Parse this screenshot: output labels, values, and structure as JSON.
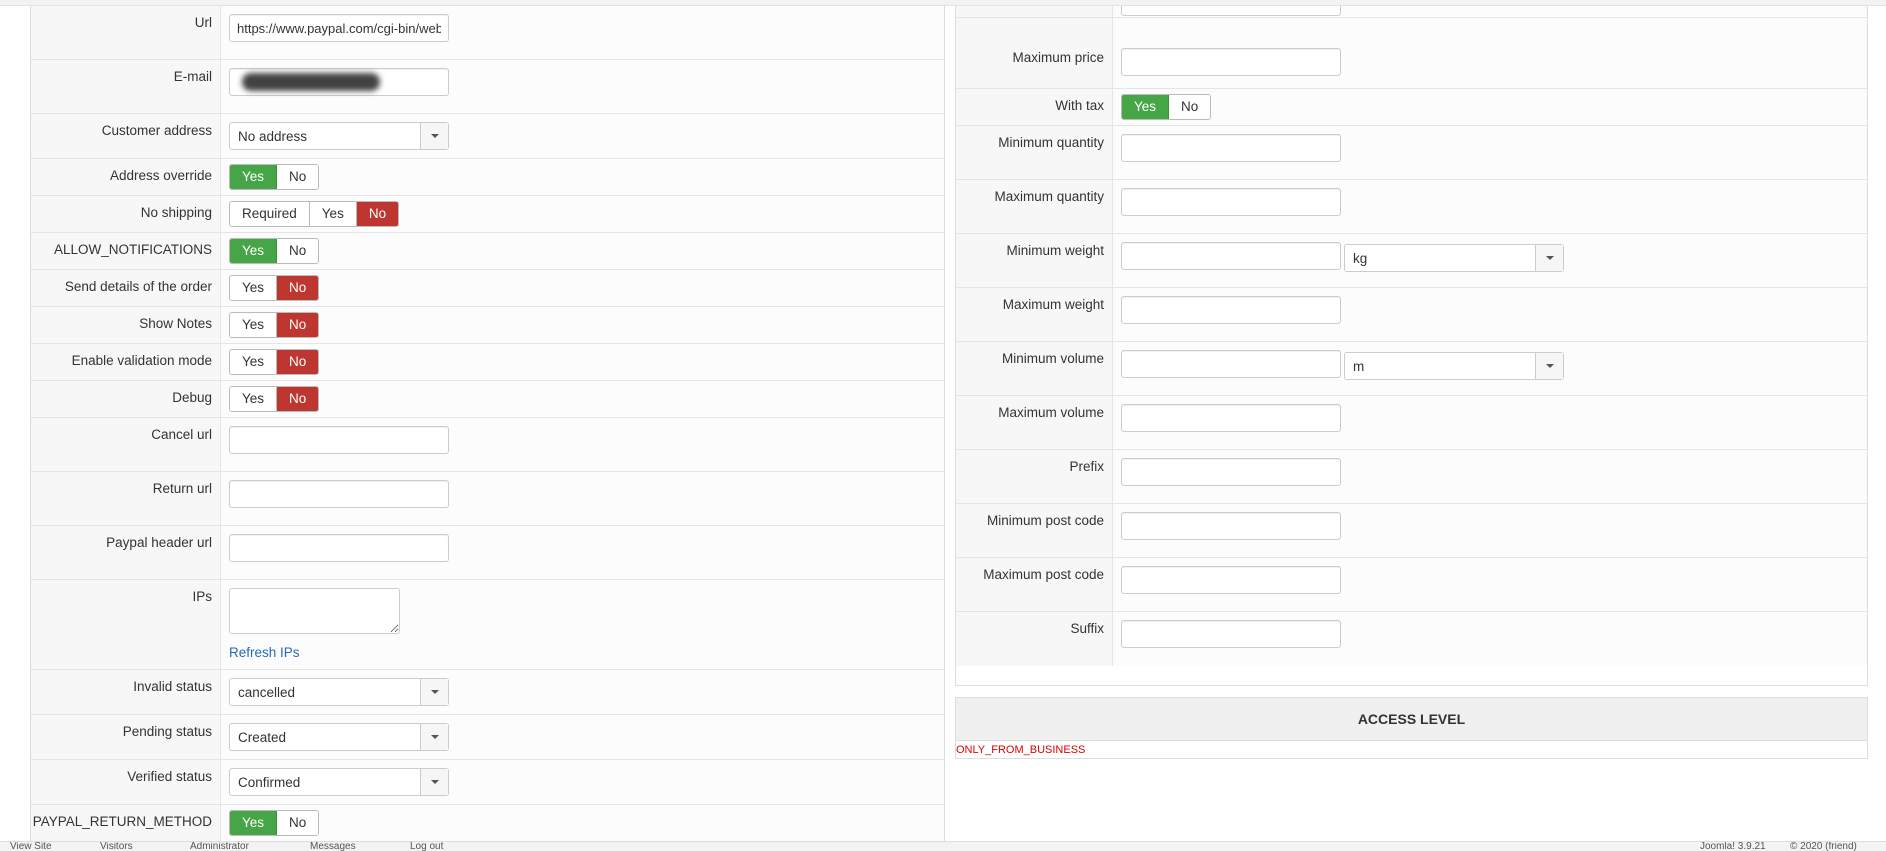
{
  "left_form": {
    "url": {
      "label": "Url",
      "value": "https://www.paypal.com/cgi-bin/web"
    },
    "email": {
      "label": "E-mail",
      "value": ""
    },
    "customer_address": {
      "label": "Customer address",
      "value": "No address"
    },
    "address_override": {
      "label": "Address override",
      "options": [
        "Yes",
        "No"
      ],
      "selected": "Yes"
    },
    "no_shipping": {
      "label": "No shipping",
      "options": [
        "Required",
        "Yes",
        "No"
      ],
      "selected": "No"
    },
    "allow_notifications": {
      "label": "ALLOW_NOTIFICATIONS",
      "options": [
        "Yes",
        "No"
      ],
      "selected": "Yes"
    },
    "send_details": {
      "label": "Send details of the order",
      "options": [
        "Yes",
        "No"
      ],
      "selected": "No"
    },
    "show_notes": {
      "label": "Show Notes",
      "options": [
        "Yes",
        "No"
      ],
      "selected": "No"
    },
    "validation_mode": {
      "label": "Enable validation mode",
      "options": [
        "Yes",
        "No"
      ],
      "selected": "No"
    },
    "debug": {
      "label": "Debug",
      "options": [
        "Yes",
        "No"
      ],
      "selected": "No"
    },
    "cancel_url": {
      "label": "Cancel url",
      "value": ""
    },
    "return_url": {
      "label": "Return url",
      "value": ""
    },
    "header_url": {
      "label": "Paypal header url",
      "value": ""
    },
    "ips": {
      "label": "IPs",
      "value": "",
      "refresh_label": "Refresh IPs"
    },
    "invalid_status": {
      "label": "Invalid status",
      "value": "cancelled"
    },
    "pending_status": {
      "label": "Pending status",
      "value": "Created"
    },
    "verified_status": {
      "label": "Verified status",
      "value": "Confirmed"
    },
    "return_method": {
      "label": "PAYPAL_RETURN_METHOD",
      "options": [
        "Yes",
        "No"
      ],
      "selected": "Yes"
    }
  },
  "right_form": {
    "max_price": {
      "label": "Maximum price",
      "value": ""
    },
    "with_tax": {
      "label": "With tax",
      "options": [
        "Yes",
        "No"
      ],
      "selected": "Yes"
    },
    "min_qty": {
      "label": "Minimum quantity",
      "value": ""
    },
    "max_qty": {
      "label": "Maximum quantity",
      "value": ""
    },
    "min_weight": {
      "label": "Minimum weight",
      "value": "",
      "unit": "kg"
    },
    "max_weight": {
      "label": "Maximum weight",
      "value": ""
    },
    "min_volume": {
      "label": "Minimum volume",
      "value": "",
      "unit": "m"
    },
    "max_volume": {
      "label": "Maximum volume",
      "value": ""
    },
    "prefix": {
      "label": "Prefix",
      "value": ""
    },
    "min_post": {
      "label": "Minimum post code",
      "value": ""
    },
    "max_post": {
      "label": "Maximum post code",
      "value": ""
    },
    "suffix": {
      "label": "Suffix",
      "value": ""
    }
  },
  "access_level": {
    "title": "ACCESS LEVEL",
    "message": "ONLY_FROM_BUSINESS"
  },
  "statusbar": {
    "view_site": "View Site",
    "visitors": "Visitors",
    "administrator": "Administrator",
    "messages": "Messages",
    "logout": "Log out",
    "version": "Joomla! 3.9.21",
    "copyright": "© 2020 (friend)"
  },
  "colors": {
    "yes_active": "#46a546",
    "no_active": "#bd362f",
    "link": "#2a69b8",
    "warning_text": "#dd0000"
  }
}
